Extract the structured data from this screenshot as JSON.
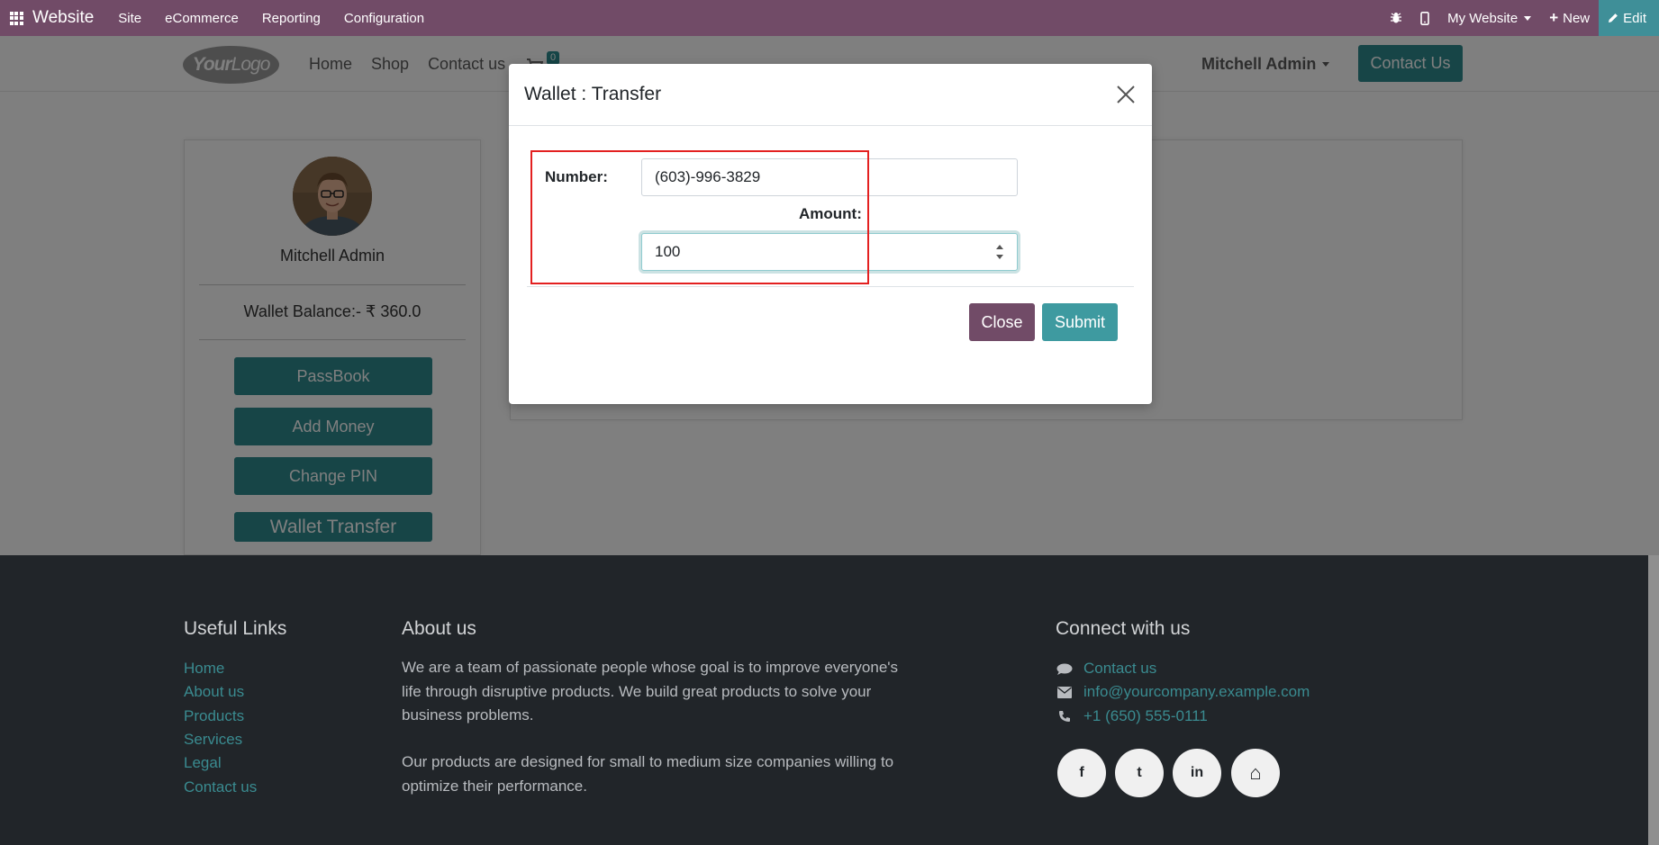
{
  "topbar": {
    "brand": "Website",
    "menu": [
      "Site",
      "eCommerce",
      "Reporting",
      "Configuration"
    ],
    "website_selector": "My Website",
    "new_label": "New",
    "edit_label": "Edit",
    "bg_color": "#714b67",
    "edit_bg_color": "#3f8f98"
  },
  "header": {
    "logo_text_bold": "Your",
    "logo_text_thin": "Logo",
    "nav": [
      "Home",
      "Shop",
      "Contact us"
    ],
    "cart_count": "0",
    "user_name": "Mitchell Admin",
    "contact_button": "Contact Us",
    "accent_color": "#2f8a8f"
  },
  "profile": {
    "name": "Mitchell Admin",
    "wallet_balance": "Wallet Balance:- ₹ 360.0",
    "buttons": [
      "PassBook",
      "Add Money",
      "Change PIN",
      "Wallet Transfer"
    ]
  },
  "modal": {
    "title": "Wallet : Transfer",
    "number_label": "Number:",
    "number_value": "(603)-996-3829",
    "amount_label": "Amount:",
    "amount_value": "100",
    "close_button": "Close",
    "submit_button": "Submit",
    "close_color": "#714b67",
    "submit_color": "#3e9aa0",
    "highlight_color": "#e32020"
  },
  "footer": {
    "useful_links_title": "Useful Links",
    "useful_links": [
      "Home",
      "About us",
      "Products",
      "Services",
      "Legal",
      "Contact us"
    ],
    "about_title": "About us",
    "about_p1_lines": [
      "We are a team of passionate people whose goal is to improve everyone's",
      "life through disruptive products. We build great products to solve your",
      "business problems."
    ],
    "about_p2_lines": [
      "Our products are designed for small to medium size companies willing to",
      "optimize their performance."
    ],
    "connect_title": "Connect with us",
    "connect_items": [
      {
        "icon": "comment-icon",
        "text": "Contact us"
      },
      {
        "icon": "envelope-icon",
        "text": "info@yourcompany.example.com"
      },
      {
        "icon": "phone-icon",
        "text": "+1 (650) 555-0111"
      }
    ],
    "social": [
      {
        "icon": "facebook-icon",
        "glyph": "f"
      },
      {
        "icon": "twitter-icon",
        "glyph": "t"
      },
      {
        "icon": "linkedin-icon",
        "glyph": "in"
      },
      {
        "icon": "home-icon",
        "glyph": "⌂"
      }
    ],
    "bg_color": "#212529",
    "link_color": "#3a8b90"
  }
}
